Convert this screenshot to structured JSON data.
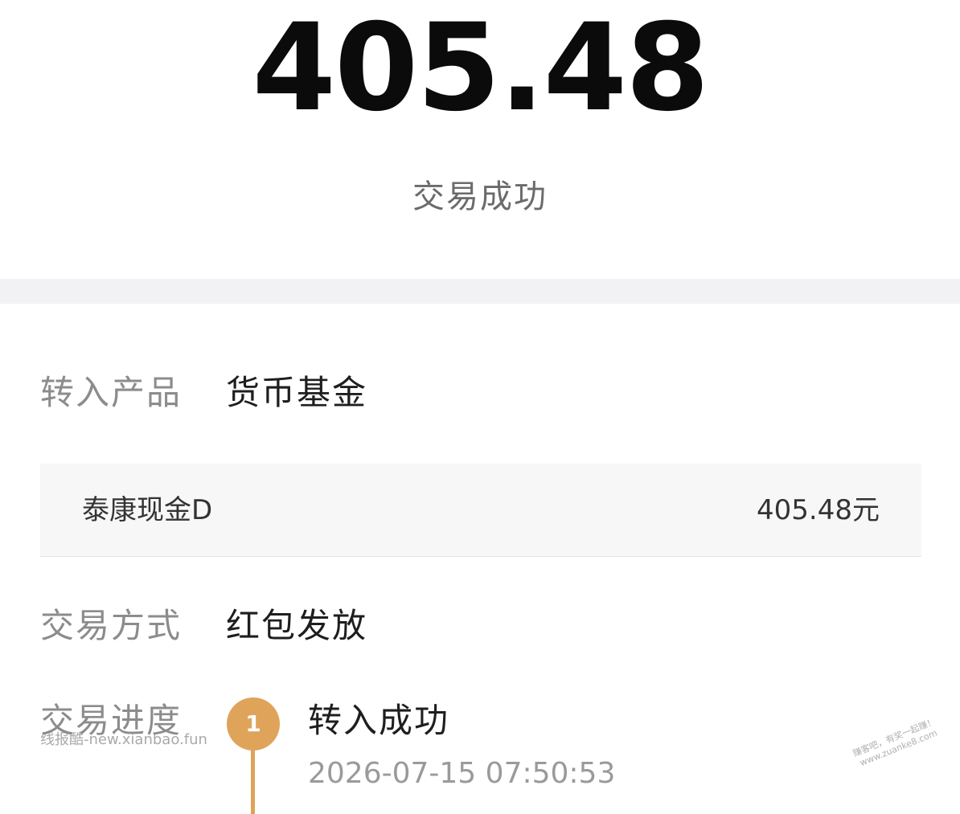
{
  "summary": {
    "amount": "405.48",
    "status": "交易成功"
  },
  "details": {
    "product_label": "转入产品",
    "product_value": "货币基金",
    "product_card": {
      "name": "泰康现金D",
      "amount": "405.48元"
    },
    "method_label": "交易方式",
    "method_value": "红包发放",
    "progress_label": "交易进度"
  },
  "progress": {
    "steps": [
      {
        "index": "1",
        "title": "转入成功",
        "time": "2026-07-15 07:50:53"
      }
    ]
  },
  "watermarks": {
    "left": "线报酷-new.xianbao.fun",
    "right_line1": "赚客吧，有奖一起赚！",
    "right_line2": "www.zuanke8.com"
  },
  "colors": {
    "accent": "#dfa35a",
    "label": "#8c8c8c",
    "value": "#1e1e1e",
    "band": "#f2f2f4",
    "card": "#f7f7f7"
  }
}
